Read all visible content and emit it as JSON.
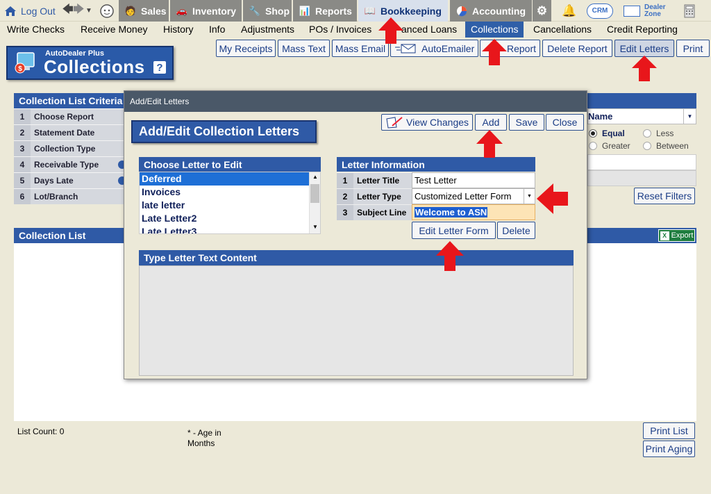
{
  "topbar": {
    "logout": "Log Out",
    "tabs": [
      {
        "label": "Sales",
        "icon": "salesperson-icon"
      },
      {
        "label": "Inventory",
        "icon": "car-icon"
      },
      {
        "label": "Shop",
        "icon": "wrench-icon"
      },
      {
        "label": "Reports",
        "icon": "report-icon"
      },
      {
        "label": "Bookkeeping",
        "icon": "book-icon"
      },
      {
        "label": "Accounting",
        "icon": "pie-chart-icon"
      }
    ],
    "crm_label": "CRM",
    "dealer_zone_label1": "Dealer",
    "dealer_zone_label2": "Zone"
  },
  "menubar": {
    "items": [
      "Write Checks",
      "Receive Money",
      "History",
      "Info",
      "Adjustments",
      "POs / Invoices",
      "anced Loans",
      "Collections",
      "Cancellations",
      "Credit Reporting"
    ]
  },
  "logo": {
    "small": "AutoDealer Plus",
    "big": "Collections",
    "help": "?"
  },
  "toolbar": {
    "buttons": [
      "My Receipts",
      "Mass Text",
      "Mass Email",
      "AutoEmailer",
      "Report",
      "Delete Report",
      "Edit Letters",
      "Print"
    ]
  },
  "criteria": {
    "title": "Collection List Criteria",
    "rows": [
      {
        "num": "1",
        "label": "Choose Report"
      },
      {
        "num": "2",
        "label": "Statement Date"
      },
      {
        "num": "3",
        "label": "Collection Type"
      },
      {
        "num": "4",
        "label": "Receivable Type"
      },
      {
        "num": "5",
        "label": "Days Late"
      },
      {
        "num": "6",
        "label": "Lot/Branch"
      }
    ],
    "name_select": "Name",
    "radios": [
      "Equal",
      "Less",
      "Greater",
      "Between"
    ],
    "reset": "Reset Filters"
  },
  "collection_list": {
    "title": "Collection List",
    "export": "Export",
    "count": "List Count: 0",
    "age_note1": "* - Age in",
    "age_note2": "Months",
    "print_list": "Print List",
    "print_aging": "Print Aging"
  },
  "dialog": {
    "window_title": "Add/Edit Letters",
    "heading": "Add/Edit Collection Letters",
    "buttons": {
      "view_changes": "View Changes",
      "add": "Add",
      "save": "Save",
      "close": "Close"
    },
    "choose_title": "Choose Letter to Edit",
    "letters": [
      "Deferred",
      "Invoices",
      "late letter",
      "Late Letter2",
      "Late Letter3"
    ],
    "info_title": "Letter Information",
    "info": [
      {
        "num": "1",
        "label": "Letter Title",
        "value": "Test Letter"
      },
      {
        "num": "2",
        "label": "Letter Type",
        "value": "Customized Letter Form"
      },
      {
        "num": "3",
        "label": "Subject Line",
        "value": "Welcome to ASN"
      }
    ],
    "edit_form": "Edit Letter Form",
    "delete": "Delete",
    "content_title": "Type Letter Text Content"
  },
  "colors": {
    "accent": "#2f5aa6",
    "arrow": "#e8161b"
  }
}
